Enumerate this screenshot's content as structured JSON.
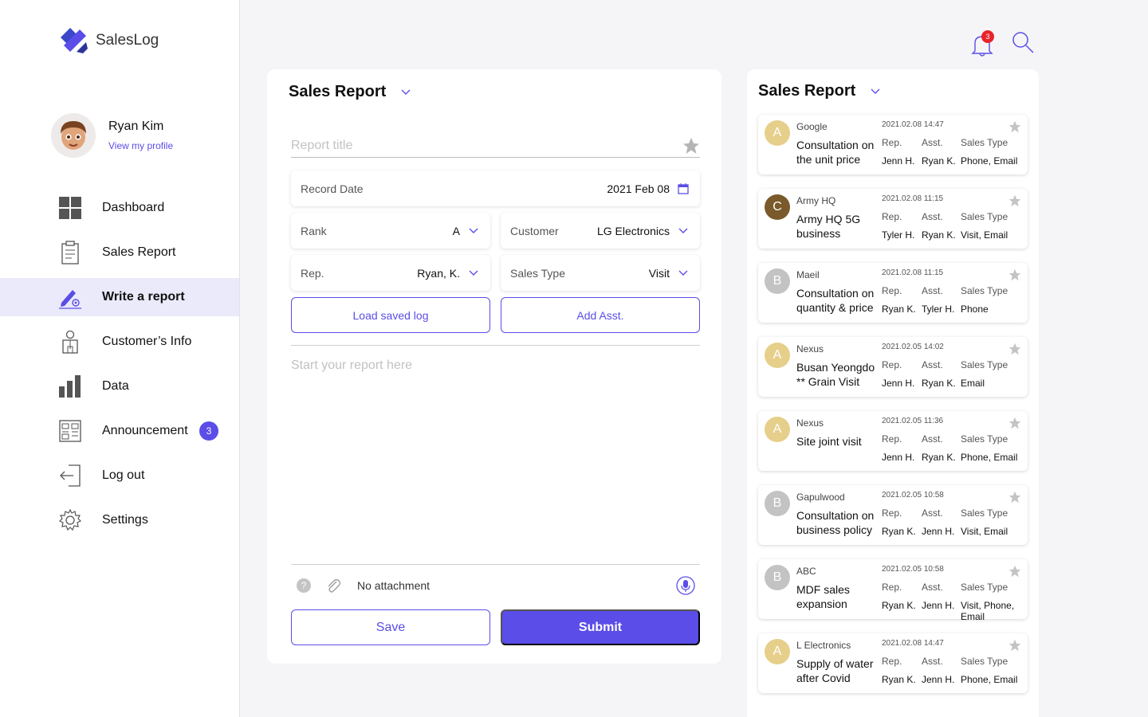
{
  "app": {
    "name": "SalesLog"
  },
  "profile": {
    "name": "Ryan Kim",
    "link": "View my profile"
  },
  "nav": [
    {
      "label": "Dashboard",
      "icon": "dashboard-icon"
    },
    {
      "label": "Sales Report",
      "icon": "clipboard-icon"
    },
    {
      "label": "Write a report",
      "icon": "pen-icon",
      "active": true
    },
    {
      "label": "Customer’s Info",
      "icon": "person-icon"
    },
    {
      "label": "Data",
      "icon": "bar-chart-icon"
    },
    {
      "label": "Announcement",
      "icon": "newspaper-icon",
      "badge": "3"
    },
    {
      "label": "Log out",
      "icon": "logout-icon"
    },
    {
      "label": "Settings",
      "icon": "gear-icon"
    }
  ],
  "header": {
    "notification_count": "3"
  },
  "form": {
    "title": "Sales Report",
    "report_title_placeholder": "Report title",
    "record_date": {
      "label": "Record Date",
      "value": "2021 Feb 08"
    },
    "rank": {
      "label": "Rank",
      "value": "A"
    },
    "customer": {
      "label": "Customer",
      "value": "LG Electronics"
    },
    "rep": {
      "label": "Rep.",
      "value": "Ryan, K."
    },
    "sales_type": {
      "label": "Sales Type",
      "value": "Visit"
    },
    "load_saved_label": "Load saved log",
    "add_asst_label": "Add Asst.",
    "body_placeholder": "Start your report here",
    "attachment_text": "No attachment",
    "save_label": "Save",
    "submit_label": "Submit"
  },
  "list": {
    "title": "Sales Report",
    "col_rep": "Rep.",
    "col_asst": "Asst.",
    "col_type": "Sales Type",
    "reports": [
      {
        "initial": "A",
        "avatar_color": "#e6cf8a",
        "company": "Google",
        "title": "Consultation on the unit price",
        "date": "2021.02.08 14:47",
        "rep": "Jenn H.",
        "asst": "Ryan K.",
        "type": "Phone, Email"
      },
      {
        "initial": "C",
        "avatar_color": "#7a5a2a",
        "company": "Army HQ",
        "title": "Army HQ 5G business",
        "date": "2021.02.08 11:15",
        "rep": "Tyler H.",
        "asst": "Ryan K.",
        "type": "Visit, Email"
      },
      {
        "initial": "B",
        "avatar_color": "#c3c3c3",
        "company": "Maeil",
        "title": "Consultation on quantity & price",
        "date": "2021.02.08 11:15",
        "rep": "Ryan K.",
        "asst": "Tyler H.",
        "type": "Phone"
      },
      {
        "initial": "A",
        "avatar_color": "#e6cf8a",
        "company": "Nexus",
        "title": "Busan Yeongdo ** Grain Visit",
        "date": "2021.02.05 14:02",
        "rep": "Jenn H.",
        "asst": "Ryan K.",
        "type": "Email"
      },
      {
        "initial": "A",
        "avatar_color": "#e6cf8a",
        "company": "Nexus",
        "title": "Site joint visit",
        "date": "2021.02.05 11:36",
        "rep": "Jenn H.",
        "asst": "Ryan K.",
        "type": "Phone, Email"
      },
      {
        "initial": "B",
        "avatar_color": "#c3c3c3",
        "company": "Gapulwood",
        "title": "Consultation on business policy",
        "date": "2021.02.05 10:58",
        "rep": "Ryan K.",
        "asst": "Jenn H.",
        "type": "Visit, Email"
      },
      {
        "initial": "B",
        "avatar_color": "#c3c3c3",
        "company": "ABC",
        "title": "MDF sales expansion",
        "date": "2021.02.05 10:58",
        "rep": "Ryan K.",
        "asst": "Jenn H.",
        "type": "Visit, Phone, Email"
      },
      {
        "initial": "A",
        "avatar_color": "#e6cf8a",
        "company": "L Electronics",
        "title": "Supply of water after Covid",
        "date": "2021.02.08 14:47",
        "rep": "Ryan K.",
        "asst": "Jenn H.",
        "type": "Phone, Email"
      }
    ]
  },
  "colors": {
    "accent": "#5b4de8",
    "badge_red": "#e8242a"
  }
}
